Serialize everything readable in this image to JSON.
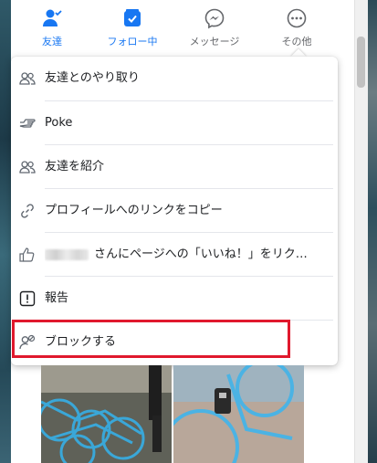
{
  "nav": {
    "items": [
      {
        "label": "友達",
        "icon": "person-check-icon"
      },
      {
        "label": "フォロー中",
        "icon": "follow-check-icon"
      },
      {
        "label": "メッセージ",
        "icon": "messenger-icon"
      },
      {
        "label": "その他",
        "icon": "more-icon"
      }
    ]
  },
  "menu": {
    "items": [
      {
        "label": "友達とのやり取り",
        "icon": "friends-icon"
      },
      {
        "label": "Poke",
        "icon": "poke-hand-icon"
      },
      {
        "label": "友達を紹介",
        "icon": "suggest-friends-icon"
      },
      {
        "label": "プロフィールへのリンクをコピー",
        "icon": "link-icon"
      },
      {
        "label": "さんにページへの「いいね！」をリク…",
        "icon": "thumbs-up-icon"
      },
      {
        "label": "報告",
        "icon": "report-icon"
      },
      {
        "label": "ブロックする",
        "icon": "block-user-icon"
      }
    ]
  },
  "colors": {
    "accent": "#1877f2",
    "highlight": "#e0192d",
    "text": "#1c1e21",
    "muted": "#65676b"
  }
}
